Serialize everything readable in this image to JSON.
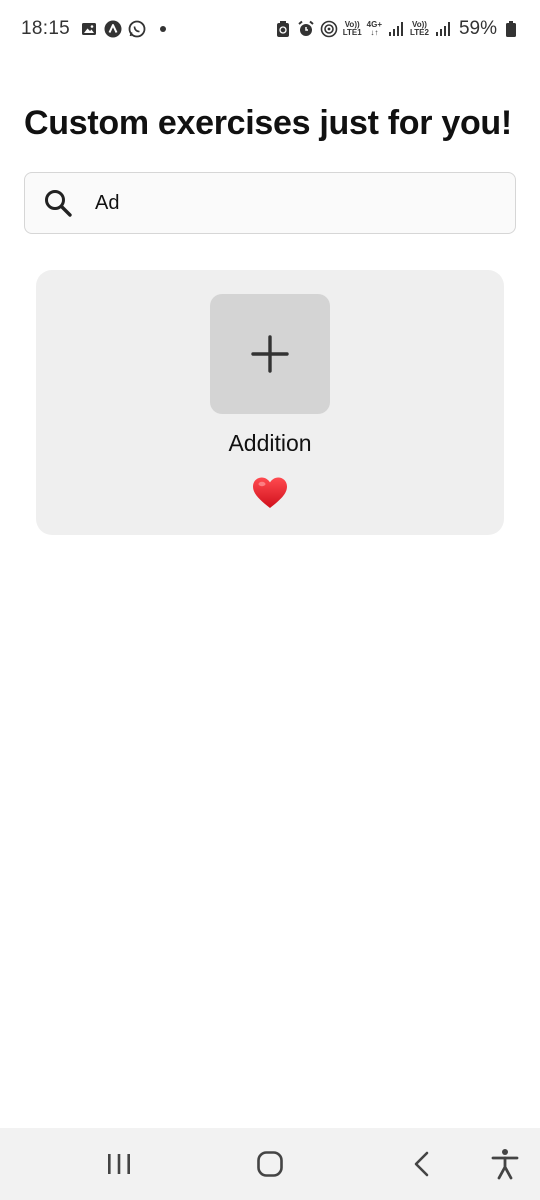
{
  "status_bar": {
    "time": "18:15",
    "net1": [
      "Vo))",
      "LTE1"
    ],
    "net_type": [
      "4G+",
      "↓↑"
    ],
    "net2": [
      "Vo))",
      "LTE2"
    ],
    "battery": "59%"
  },
  "page": {
    "title": "Custom exercises just for you!"
  },
  "search": {
    "value": "Ad",
    "icon": "search-icon"
  },
  "results": [
    {
      "label": "Addition",
      "thumb_icon": "plus-icon",
      "favorite_icon": "heart-icon",
      "favorite_color": "#e3212b"
    }
  ],
  "nav": {
    "recents_icon": "recents-icon",
    "home_icon": "home-icon",
    "back_icon": "back-icon",
    "accessibility_icon": "accessibility-icon"
  }
}
